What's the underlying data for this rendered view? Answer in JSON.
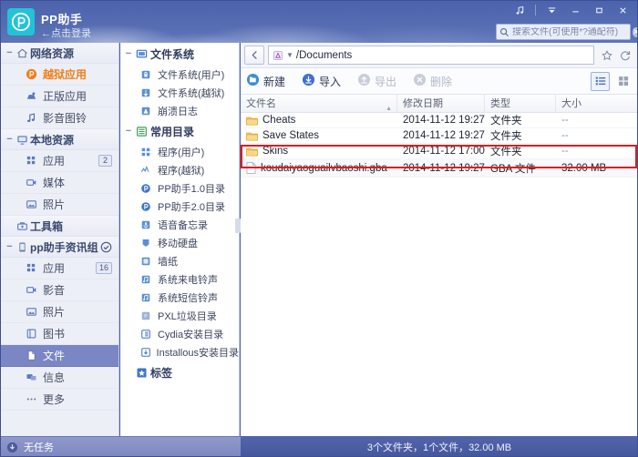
{
  "header": {
    "app_title": "PP助手",
    "login_link": "←点击登录",
    "logo_letter": "P",
    "logo_color": "#22c3d6",
    "music_icon": "music-note-icon",
    "pin_icon": "pin-down-icon",
    "minimize_icon": "minimize-icon",
    "maximize_icon": "maximize-icon",
    "close_icon": "close-icon"
  },
  "search": {
    "placeholder": "搜索文件(可使用*?通配符)",
    "value": "",
    "icon": "search-icon",
    "clear_icon": "clear-icon",
    "clear_glyph": "✕"
  },
  "sidebar": {
    "groups": [
      {
        "label": "网络资源",
        "icon": "home-icon",
        "collapse_glyph": "−",
        "items": [
          {
            "label": "越狱应用",
            "icon": "pp-logo-icon",
            "state": "active",
            "badge": ""
          },
          {
            "label": "正版应用",
            "icon": "apple-store-icon",
            "badge": ""
          },
          {
            "label": "影音图铃",
            "icon": "music-note-icon",
            "badge": ""
          }
        ]
      },
      {
        "label": "本地资源",
        "icon": "monitor-icon",
        "collapse_glyph": "−",
        "items": [
          {
            "label": "应用",
            "icon": "apps-grid-icon",
            "badge": "2"
          },
          {
            "label": "媒体",
            "icon": "media-icon",
            "badge": ""
          },
          {
            "label": "照片",
            "icon": "photo-icon",
            "badge": ""
          }
        ]
      },
      {
        "label": "工具箱",
        "icon": "toolbox-icon",
        "collapse_glyph": "",
        "items": []
      },
      {
        "label": "pp助手资讯组",
        "icon": "device-icon",
        "collapse_glyph": "−",
        "check_icon": "check-circle-icon",
        "items": [
          {
            "label": "应用",
            "icon": "apps-grid-icon",
            "badge": "16"
          },
          {
            "label": "影音",
            "icon": "media-icon",
            "badge": ""
          },
          {
            "label": "照片",
            "icon": "photo-icon",
            "badge": ""
          },
          {
            "label": "图书",
            "icon": "book-icon",
            "badge": ""
          },
          {
            "label": "文件",
            "icon": "file-icon",
            "state": "selected",
            "badge": ""
          },
          {
            "label": "信息",
            "icon": "message-icon",
            "badge": ""
          },
          {
            "label": "更多",
            "icon": "more-dots-icon",
            "badge": ""
          }
        ]
      }
    ],
    "status": {
      "label": "无任务",
      "icon": "download-icon"
    }
  },
  "tree": {
    "sections": [
      {
        "label": "文件系统",
        "icon": "monitor-icon",
        "collapse_glyph": "−",
        "items": [
          {
            "label": "文件系统(用户)",
            "icon": "lock-folder-icon"
          },
          {
            "label": "文件系统(越狱)",
            "icon": "jailbreak-icon"
          },
          {
            "label": "崩溃日志",
            "icon": "warning-icon"
          }
        ]
      },
      {
        "label": "常用目录",
        "icon": "list-icon",
        "collapse_glyph": "−",
        "items": [
          {
            "label": "程序(用户)",
            "icon": "apps-grid-icon"
          },
          {
            "label": "程序(越狱)",
            "icon": "jailbreak-apps-icon"
          },
          {
            "label": "PP助手1.0目录",
            "icon": "pp-logo-icon"
          },
          {
            "label": "PP助手2.0目录",
            "icon": "pp-logo-icon"
          },
          {
            "label": "语音备忘录",
            "icon": "voice-memo-icon"
          },
          {
            "label": "移动硬盘",
            "icon": "hard-disk-icon"
          },
          {
            "label": "墙纸",
            "icon": "wallpaper-icon"
          },
          {
            "label": "系统来电铃声",
            "icon": "ringtone-icon"
          },
          {
            "label": "系统短信铃声",
            "icon": "sms-tone-icon"
          },
          {
            "label": "PXL垃圾目录",
            "icon": "pxl-icon"
          },
          {
            "label": "Cydia安装目录",
            "icon": "cydia-icon"
          },
          {
            "label": "Installous安装目录",
            "icon": "installous-icon"
          }
        ]
      },
      {
        "label": "标签",
        "icon": "star-icon",
        "collapse_glyph": "",
        "items": []
      }
    ]
  },
  "main": {
    "pathbar": {
      "back_icon": "back-arrow-icon",
      "drive_icon": "drive-icon",
      "caret_icon": "chevron-down-icon",
      "path": "/Documents",
      "star_icon": "star-icon",
      "refresh_icon": "refresh-icon"
    },
    "toolbar": {
      "buttons": [
        {
          "label": "新建",
          "icon": "new-folder-icon",
          "enabled": true
        },
        {
          "label": "导入",
          "icon": "import-icon",
          "enabled": true
        },
        {
          "label": "导出",
          "icon": "export-icon",
          "enabled": false
        },
        {
          "label": "删除",
          "icon": "delete-icon",
          "enabled": false
        }
      ],
      "view_list_icon": "list-view-icon",
      "view_grid_icon": "grid-view-icon",
      "active_view": "list"
    },
    "columns": [
      {
        "key": "name",
        "label": "文件名",
        "sort": "asc",
        "sort_glyph": "▲"
      },
      {
        "key": "date",
        "label": "修改日期"
      },
      {
        "key": "type",
        "label": "类型"
      },
      {
        "key": "size",
        "label": "大小"
      }
    ],
    "rows": [
      {
        "name": "Cheats",
        "date": "2014-11-12 19:27",
        "type": "文件夹",
        "size": "--",
        "icon": "folder-icon",
        "highlighted": false
      },
      {
        "name": "Save States",
        "date": "2014-11-12 19:27",
        "type": "文件夹",
        "size": "--",
        "icon": "folder-icon",
        "highlighted": false
      },
      {
        "name": "Skins",
        "date": "2014-11-12 17:00",
        "type": "文件夹",
        "size": "--",
        "icon": "folder-icon",
        "highlighted": false
      },
      {
        "name": "koudaiyaoguailvbaoshi.gba",
        "date": "2014-11-12 19:27",
        "type": "GBA 文件",
        "size": "32.00 MB",
        "icon": "file-icon",
        "highlighted": true
      }
    ],
    "status": "3个文件夹，1个文件，32.00 MB",
    "annotation_color": "#e21b1b"
  }
}
